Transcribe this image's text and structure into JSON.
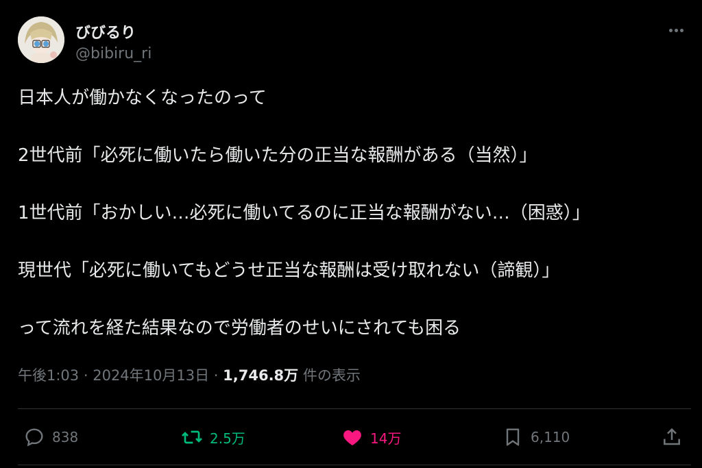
{
  "colors": {
    "background": "#000000",
    "text": "#e7e9ea",
    "secondary": "#71767b",
    "retweet": "#00ba7c",
    "like": "#f91880"
  },
  "author": {
    "display_name": "びびるり",
    "handle": "@bibiru_ri",
    "avatar_icon": "avatar-illustration"
  },
  "tweet": {
    "lines": [
      "日本人が働かなくなったのって",
      "2世代前「必死に働いたら働いた分の正当な報酬がある（当然）」",
      "1世代前「おかしい…必死に働いてるのに正当な報酬がない…（困惑）」",
      "現世代「必死に働いてもどうせ正当な報酬は受け取れない（諦観）」",
      "って流れを経た結果なので労働者のせいにされても困る"
    ]
  },
  "meta": {
    "time": "午後1:03",
    "date": "2024年10月13日",
    "views": "1,746.8万",
    "views_label": "件の表示"
  },
  "actions": {
    "replies": "838",
    "retweets": "2.5万",
    "likes": "14万",
    "bookmarks": "6,110"
  }
}
